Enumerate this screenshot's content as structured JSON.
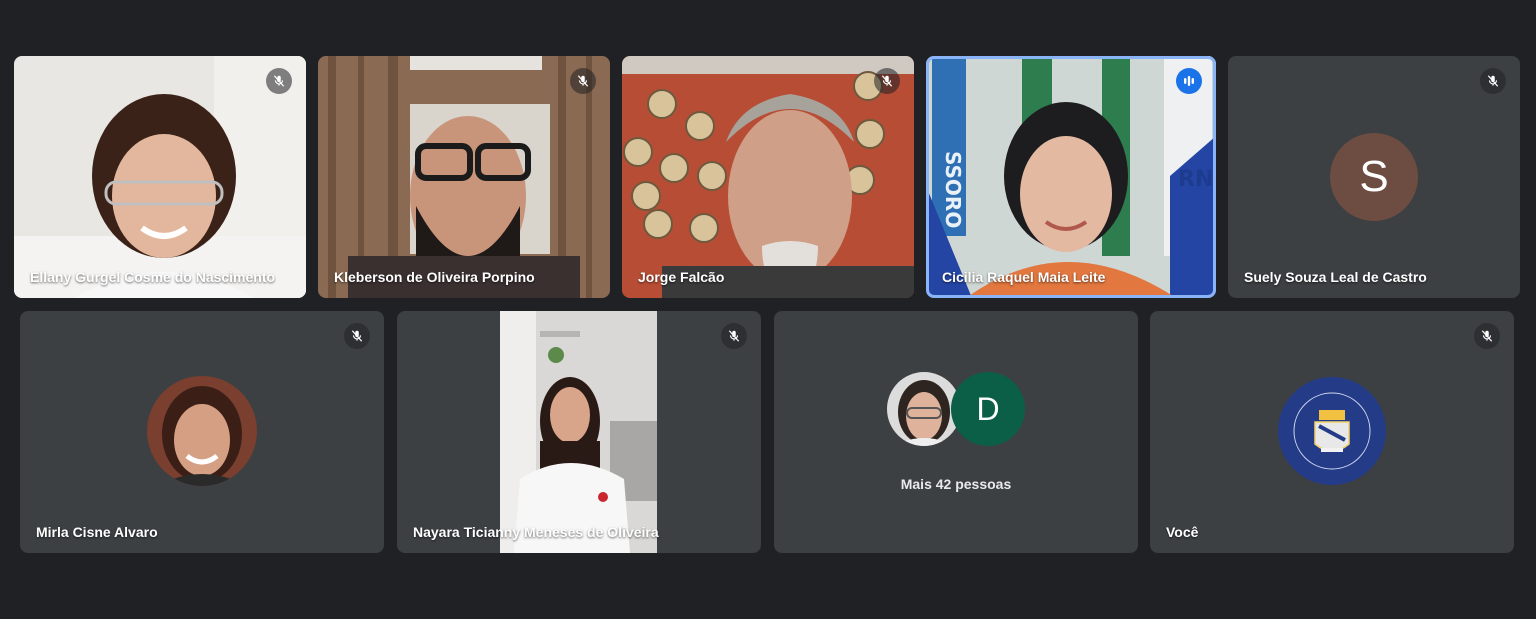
{
  "participants": [
    {
      "name": "Ellany Gurgel Cosme do Nascimento",
      "muted": true
    },
    {
      "name": "Kleberson de Oliveira Porpino",
      "muted": true
    },
    {
      "name": "Jorge Falcão",
      "muted": true
    },
    {
      "name": "Cicilia Raquel Maia Leite",
      "muted": false,
      "speaking": true
    },
    {
      "name": "Suely Souza Leal de Castro",
      "muted": true,
      "avatar_letter": "S",
      "avatar_color": "#6d4c41"
    },
    {
      "name": "Mirla Cisne Alvaro",
      "muted": true
    },
    {
      "name": "Nayara Ticianny Meneses de Oliveira",
      "muted": true
    },
    {
      "overflow_label": "Mais 42 pessoas",
      "overflow_letter": "D",
      "overflow_letter_color": "#0b5f46"
    },
    {
      "name": "Você",
      "muted": true
    }
  ],
  "colors": {
    "background": "#202124",
    "tile": "#3c4043",
    "speaking_border": "#8ab4f8",
    "speaking_badge": "#1a73e8"
  }
}
